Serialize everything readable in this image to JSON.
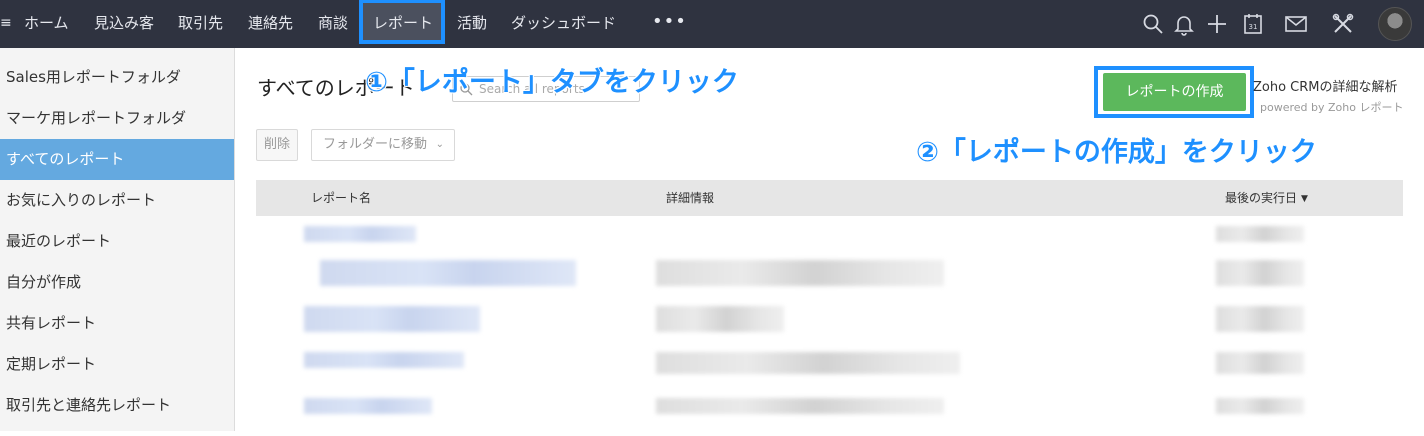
{
  "nav": {
    "menu_glyph": "≡",
    "items": [
      "ホーム",
      "見込み客",
      "取引先",
      "連絡先",
      "商談",
      "レポート",
      "活動",
      "ダッシュボード"
    ],
    "more": "•••",
    "calendar_day": "31",
    "icons": [
      "search-icon",
      "bell-icon",
      "plus-icon",
      "calendar-icon",
      "mail-icon",
      "tools-icon",
      "avatar"
    ]
  },
  "sidebar": {
    "items": [
      "Sales用レポートフォルダ",
      "マーケ用レポートフォルダ",
      "すべてのレポート",
      "お気に入りのレポート",
      "最近のレポート",
      "自分が作成",
      "共有レポート",
      "定期レポート",
      "取引先と連絡先レポート"
    ],
    "active_index": 2
  },
  "main": {
    "title": "すべてのレポート",
    "search_placeholder": "Search all reports",
    "delete_label": "削除",
    "move_label": "フォルダーに移動",
    "create_label": "レポートの作成",
    "zoho_title": "Zoho CRMの詳細な解析",
    "zoho_sub": "powered by Zoho レポート"
  },
  "annotations": {
    "step1": "①「レポート」タブをクリック",
    "step2": "②「レポートの作成」をクリック"
  },
  "table": {
    "columns": [
      "レポート名",
      "詳細情報",
      "最後の実行日"
    ]
  },
  "colors": {
    "topbar": "#2f3340",
    "accent": "#1e90ff",
    "create_button": "#5cb85c",
    "sidebar_active": "#64a9e0"
  }
}
